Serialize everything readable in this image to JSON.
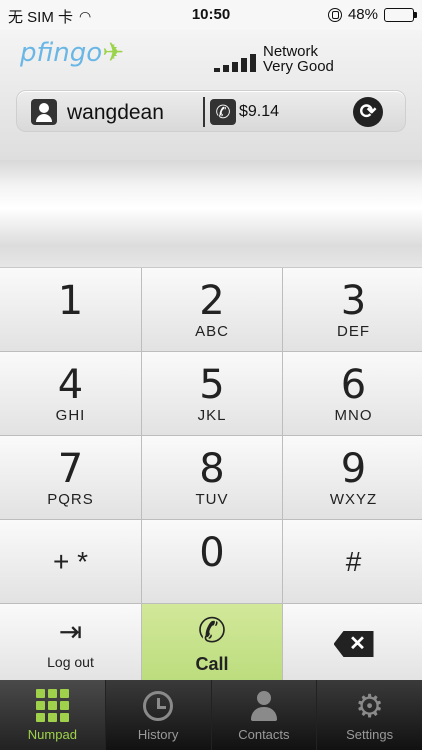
{
  "status": {
    "carrier": "无 SIM 卡",
    "time": "10:50",
    "battery": "48%",
    "battery_level": 0.48
  },
  "header": {
    "logo": "pfingo",
    "network_label": "Network",
    "network_quality": "Very Good",
    "username": "wangdean",
    "balance": "$9.14"
  },
  "display": {
    "number": ""
  },
  "keypad": {
    "keys": [
      {
        "digit": "1",
        "letters": ""
      },
      {
        "digit": "2",
        "letters": "ABC"
      },
      {
        "digit": "3",
        "letters": "DEF"
      },
      {
        "digit": "4",
        "letters": "GHI"
      },
      {
        "digit": "5",
        "letters": "JKL"
      },
      {
        "digit": "6",
        "letters": "MNO"
      },
      {
        "digit": "7",
        "letters": "PQRS"
      },
      {
        "digit": "8",
        "letters": "TUV"
      },
      {
        "digit": "9",
        "letters": "WXYZ"
      },
      {
        "digit": "+ *",
        "letters": ""
      },
      {
        "digit": "0",
        "letters": ""
      },
      {
        "digit": "#",
        "letters": ""
      }
    ],
    "logout_label": "Log out",
    "call_label": "Call"
  },
  "tabs": [
    {
      "label": "Numpad",
      "icon": "numpad-icon",
      "active": true
    },
    {
      "label": "History",
      "icon": "clock-icon",
      "active": false
    },
    {
      "label": "Contacts",
      "icon": "person-icon",
      "active": false
    },
    {
      "label": "Settings",
      "icon": "gear-icon",
      "active": false
    }
  ],
  "colors": {
    "accent": "#9fd24a",
    "call_button": "#c6e28a",
    "logo_blue": "#6ab7e6"
  }
}
